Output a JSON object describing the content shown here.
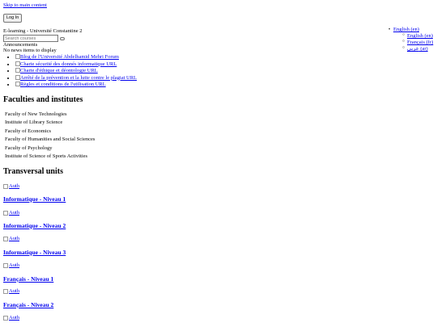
{
  "skip_link": "Skip to main content",
  "login_button": "Log In",
  "site_title": "E-learning - Université Constantine 2",
  "search": {
    "placeholder": "Search courses"
  },
  "announcements": {
    "title": "Announcements",
    "empty_text": "No news items to display"
  },
  "links": [
    "Blog de l'Université Abdelhamid Mehri Forum",
    "Charte sécurité des donnés informatique URL",
    "Charte d'éthique et déontologie URL",
    "Arrêté de la prévention et la lutte contre le plagiat URL",
    "Règles et conditions de l'utilisation URL"
  ],
  "languages": {
    "current": "English (en)",
    "options": [
      "English (en)",
      "Français (fr)",
      "عربي (ar)"
    ]
  },
  "faculties": {
    "title": "Faculties and institutes",
    "items": [
      "Faculty of New Technologies",
      "Institute of Library Science",
      "Faculty of Economics",
      "Faculty of Humanities and Social Sciences",
      "Faculty of Psychology",
      "Institute of Science of Sports Activities"
    ]
  },
  "transversal_units": {
    "title": "Transversal units",
    "image_alt": "Auth",
    "items": [
      "Informatique - Niveau 1",
      "Informatique - Niveau 2",
      "Informatique - Niveau 3",
      "Français - Niveau 1",
      "Français - Niveau 2"
    ]
  },
  "colors": {
    "link": "#0000ee",
    "text": "#000000",
    "background": "#ffffff"
  }
}
